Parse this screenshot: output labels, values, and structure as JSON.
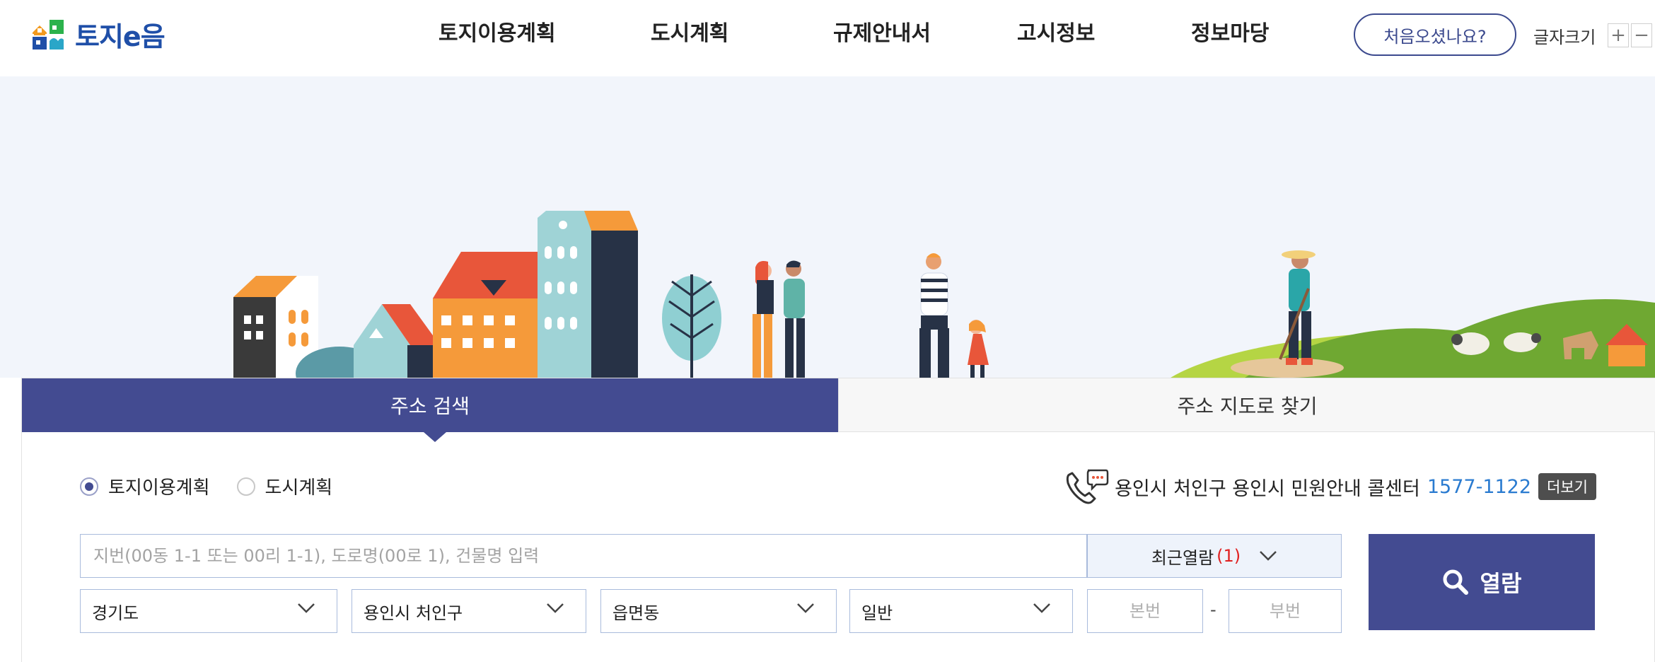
{
  "header": {
    "logo_text": "토지e음",
    "nav": [
      "토지이용계획",
      "도시계획",
      "규제안내서",
      "고시정보",
      "정보마당"
    ],
    "first_visit_label": "처음오셨나요?",
    "font_size_label": "글자크기",
    "font_plus": "+",
    "font_minus": "−"
  },
  "search": {
    "tabs": [
      "주소 검색",
      "주소 지도로 찾기"
    ],
    "radios": [
      {
        "label": "토지이용계획",
        "checked": true
      },
      {
        "label": "도시계획",
        "checked": false
      }
    ],
    "callcenter_text": "용인시 처인구 용인시 민원안내 콜센터",
    "callcenter_phone": "1577-1122",
    "more_label": "더보기",
    "address_placeholder": "지번(00동 1-1 또는 00리 1-1), 도로명(00로 1), 건물명 입력",
    "recent_label": "최근열람",
    "recent_count": "(1)",
    "selects": [
      "경기도",
      "용인시 처인구",
      "읍면동",
      "일반"
    ],
    "main_number_placeholder": "본번",
    "sub_number_placeholder": "부번",
    "dash": "-",
    "search_button_label": "열람"
  },
  "colors": {
    "primary": "#434b91",
    "logo_blue": "#1f4fa8",
    "logo_green": "#2bb24c",
    "phone_blue": "#2a7bd0",
    "count_red": "#e02020",
    "hero_bg": "#f2f5fb"
  },
  "icons": [
    "logo-icon",
    "phone-chat-icon",
    "chevron-down-icon",
    "search-icon"
  ]
}
